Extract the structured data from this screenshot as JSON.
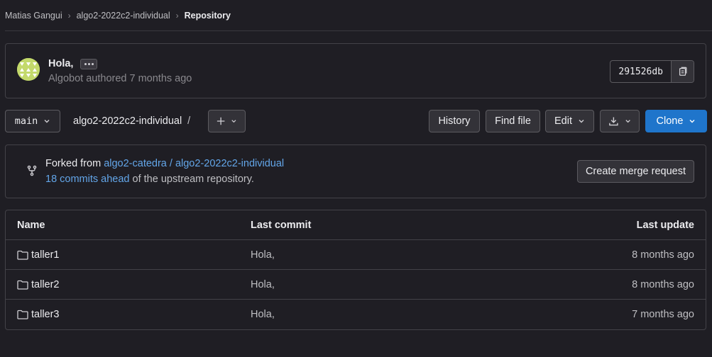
{
  "breadcrumb": {
    "items": [
      "Matias Gangui",
      "algo2-2022c2-individual",
      "Repository"
    ]
  },
  "commit": {
    "title": "Hola,",
    "author": "Algobot",
    "meta_suffix": "authored 7 months ago",
    "sha": "291526db"
  },
  "toolbar": {
    "branch": "main",
    "repo_name": "algo2-2022c2-individual",
    "path_separator": "/",
    "history_label": "History",
    "find_file_label": "Find file",
    "edit_label": "Edit",
    "clone_label": "Clone"
  },
  "fork": {
    "prefix": "Forked from",
    "source": "algo2-catedra / algo2-2022c2-individual",
    "ahead_link": "18 commits ahead",
    "ahead_suffix": "of the upstream repository.",
    "merge_request_label": "Create merge request"
  },
  "files": {
    "columns": [
      "Name",
      "Last commit",
      "Last update"
    ],
    "rows": [
      {
        "name": "taller1",
        "commit": "Hola,",
        "updated": "8 months ago"
      },
      {
        "name": "taller2",
        "commit": "Hola,",
        "updated": "8 months ago"
      },
      {
        "name": "taller3",
        "commit": "Hola,",
        "updated": "7 months ago"
      }
    ]
  },
  "colors": {
    "background": "#1f1e24",
    "primary_button": "#1f75cb",
    "link": "#63a6e9",
    "avatar": "#c3d96b"
  },
  "icons": [
    "chevron-right-icon",
    "ellipsis-icon",
    "copy-icon",
    "chevron-down-icon",
    "plus-icon",
    "download-icon",
    "fork-icon",
    "folder-icon"
  ]
}
